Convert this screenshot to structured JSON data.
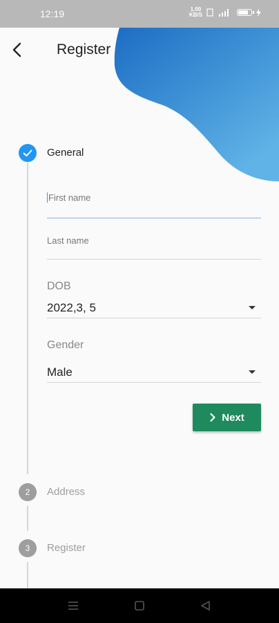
{
  "status_bar": {
    "time": "12:19",
    "net_speed": "1.00",
    "net_unit": "KB/S",
    "battery_text": "85"
  },
  "header": {
    "title": "Register",
    "back_icon": "arrow-back-icon"
  },
  "stepper": {
    "steps": [
      {
        "number": "1",
        "label": "General",
        "state": "active",
        "icon": "check-icon"
      },
      {
        "number": "2",
        "label": "Address",
        "state": "inactive"
      },
      {
        "number": "3",
        "label": "Register",
        "state": "inactive"
      }
    ]
  },
  "form": {
    "first_name": {
      "placeholder": "First name",
      "value": ""
    },
    "last_name": {
      "placeholder": "Last name",
      "value": ""
    },
    "dob": {
      "label": "DOB",
      "value": "2022,3, 5"
    },
    "gender": {
      "label": "Gender",
      "value": "Male"
    },
    "next_button": {
      "label": "Next",
      "icon": "chevron-right-icon"
    }
  },
  "colors": {
    "accent": "#2196f3",
    "button": "#1f8a5e",
    "blob_start": "#1565c0",
    "blob_end": "#5fb3e6"
  },
  "nav_bar": {
    "items": [
      "menu-icon",
      "home-square-icon",
      "back-triangle-icon"
    ]
  }
}
